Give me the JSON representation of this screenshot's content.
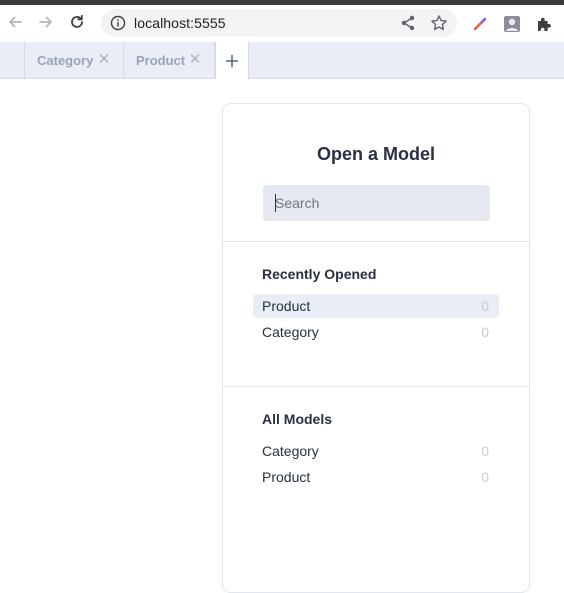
{
  "browser": {
    "url": "localhost:5555"
  },
  "tabs": [
    {
      "label": "Category"
    },
    {
      "label": "Product"
    }
  ],
  "tab_close_glyph": "✕",
  "tab_add_glyph": "+",
  "dialog": {
    "title": "Open a Model",
    "search_placeholder": "Search",
    "recent": {
      "heading": "Recently Opened",
      "items": [
        {
          "name": "Product",
          "count": "0",
          "active": true
        },
        {
          "name": "Category",
          "count": "0",
          "active": false
        }
      ]
    },
    "all": {
      "heading": "All Models",
      "items": [
        {
          "name": "Category",
          "count": "0"
        },
        {
          "name": "Product",
          "count": "0"
        }
      ]
    }
  },
  "colors": {
    "tabbar_bg": "#e9edf5",
    "text_dark": "#2a3041",
    "muted": "#c6ccd8"
  },
  "icons": [
    "back-arrow-icon",
    "forward-arrow-icon",
    "reload-icon",
    "info-icon",
    "share-icon",
    "star-icon",
    "color-picker-icon",
    "profile-icon",
    "puzzle-extension-icon"
  ]
}
